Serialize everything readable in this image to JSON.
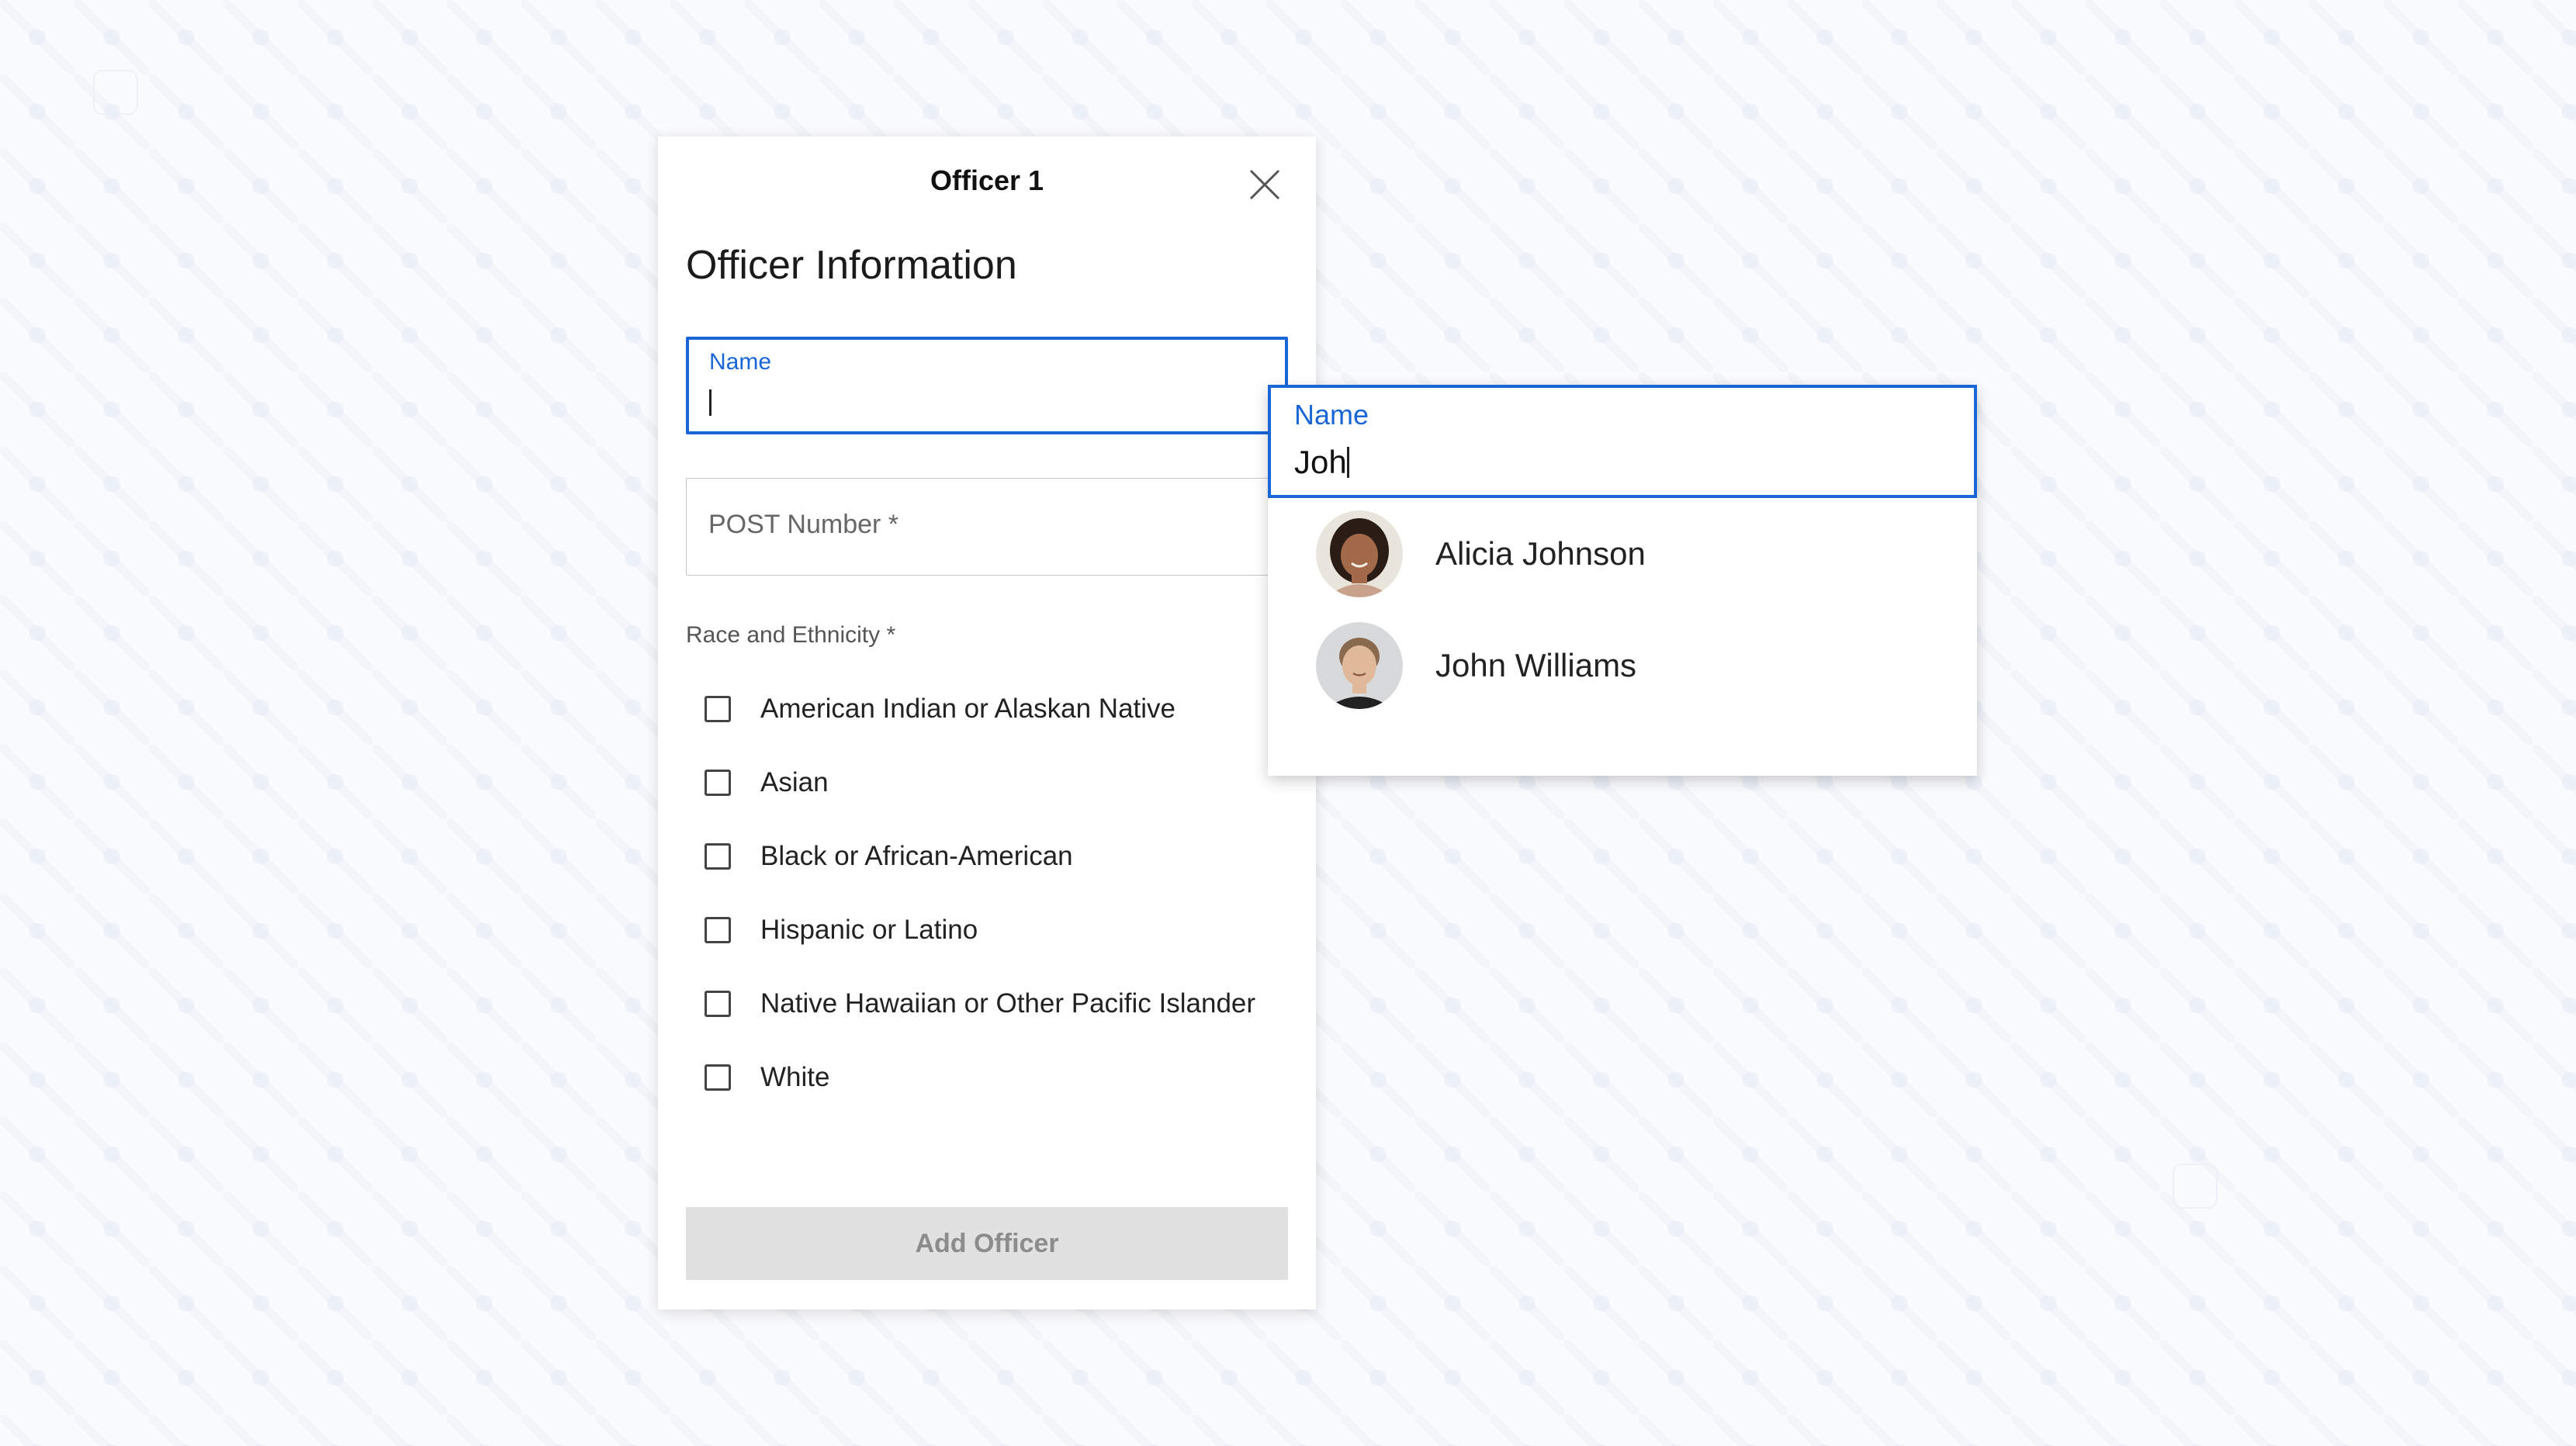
{
  "modal": {
    "title": "Officer 1",
    "section_title": "Officer Information",
    "name_field": {
      "label": "Name",
      "value": ""
    },
    "post_field": {
      "placeholder": "POST Number *"
    },
    "race_group": {
      "label": "Race and Ethnicity *",
      "options": [
        {
          "label": "American Indian or Alaskan Native",
          "checked": false
        },
        {
          "label": "Asian",
          "checked": false
        },
        {
          "label": "Black or African-American",
          "checked": false
        },
        {
          "label": "Hispanic or Latino",
          "checked": false
        },
        {
          "label": "Native Hawaiian or Other Pacific Islander",
          "checked": false
        },
        {
          "label": "White",
          "checked": false
        }
      ]
    },
    "submit_label": "Add Officer"
  },
  "autocomplete": {
    "label": "Name",
    "value": "Joh",
    "suggestions": [
      {
        "name": "Alicia Johnson",
        "avatar_icon": "person-photo-icon"
      },
      {
        "name": "John Williams",
        "avatar_icon": "person-photo-icon"
      }
    ]
  },
  "colors": {
    "accent": "#1a66d6",
    "disabled_button_bg": "#e1e1e1",
    "disabled_button_text": "#8c8c8c"
  }
}
